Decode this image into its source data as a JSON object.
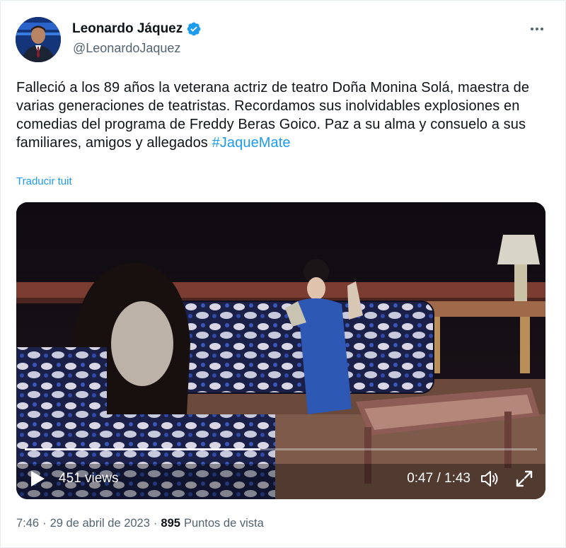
{
  "author": {
    "display_name": "Leonardo Jáquez",
    "handle": "@LeonardoJaquez",
    "verified_icon": "verified-badge-icon"
  },
  "tweet": {
    "text": "Falleció a los 89 años la veterana actriz de teatro Doña Monina Solá, maestra de varias generaciones de teatristas. Recordamos sus inolvidables explosiones en comedias del programa de Freddy Beras Goico. Paz a su alma y consuelo a sus familiares, amigos y allegados",
    "hashtag": "#JaqueMate",
    "translate_label": "Traducir tuit"
  },
  "video": {
    "views": "451 views",
    "timecode": "0:47 / 1:43",
    "progress": 0.46
  },
  "footer": {
    "time": "7:46",
    "separator": "·",
    "date": "29 de abril de 2023",
    "views_count": "895",
    "views_label": "Puntos de vista"
  },
  "colors": {
    "accent": "#1d9bf0",
    "text": "#0f1419",
    "secondary": "#536471"
  }
}
